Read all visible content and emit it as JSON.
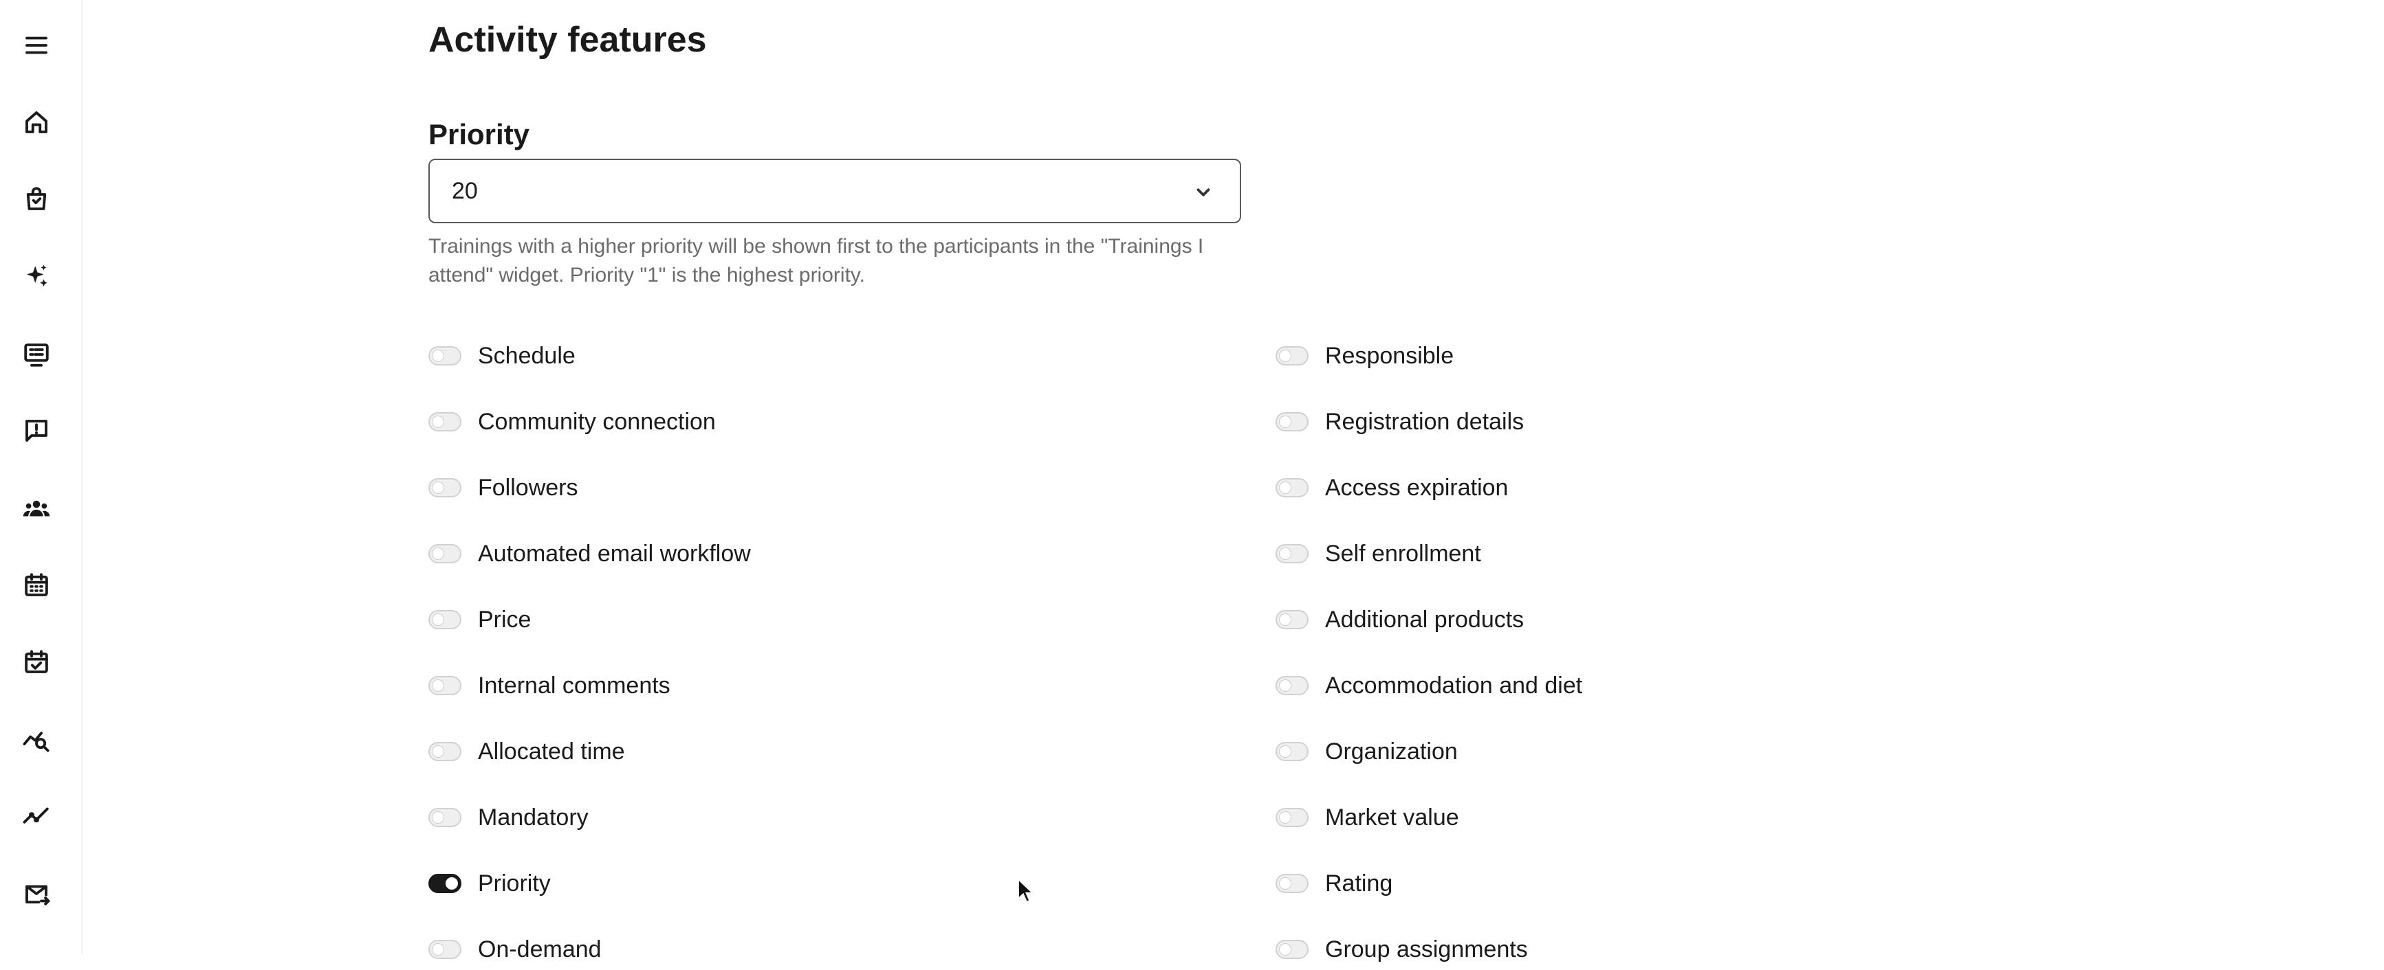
{
  "sidebar": {
    "items": [
      {
        "icon": "menu-icon"
      },
      {
        "icon": "home-icon"
      },
      {
        "icon": "shopping-bag-icon"
      },
      {
        "icon": "sparkles-icon"
      },
      {
        "icon": "monitor-list-icon"
      },
      {
        "icon": "feedback-icon"
      },
      {
        "icon": "users-icon"
      },
      {
        "icon": "calendar-icon"
      },
      {
        "icon": "calendar-check-icon"
      },
      {
        "icon": "analytics-search-icon"
      },
      {
        "icon": "trend-icon"
      },
      {
        "icon": "mail-forward-icon"
      }
    ]
  },
  "page": {
    "title": "Activity features",
    "priority": {
      "label": "Priority",
      "value": "20",
      "help": "Trainings with a higher priority will be shown first to the participants in the \"Trainings I attend\" widget. Priority \"1\" is the highest priority."
    }
  },
  "features": {
    "left": [
      {
        "label": "Schedule",
        "on": false
      },
      {
        "label": "Community connection",
        "on": false
      },
      {
        "label": "Followers",
        "on": false
      },
      {
        "label": "Automated email workflow",
        "on": false
      },
      {
        "label": "Price",
        "on": false
      },
      {
        "label": "Internal comments",
        "on": false
      },
      {
        "label": "Allocated time",
        "on": false
      },
      {
        "label": "Mandatory",
        "on": false
      },
      {
        "label": "Priority",
        "on": true
      },
      {
        "label": "On-demand",
        "on": false
      }
    ],
    "right": [
      {
        "label": "Responsible",
        "on": false
      },
      {
        "label": "Registration details",
        "on": false
      },
      {
        "label": "Access expiration",
        "on": false
      },
      {
        "label": "Self enrollment",
        "on": false
      },
      {
        "label": "Additional products",
        "on": false
      },
      {
        "label": "Accommodation and diet",
        "on": false
      },
      {
        "label": "Organization",
        "on": false
      },
      {
        "label": "Market value",
        "on": false
      },
      {
        "label": "Rating",
        "on": false
      },
      {
        "label": "Group assignments",
        "on": false
      }
    ]
  },
  "colors": {
    "toggle_on": "#1a1a1a",
    "toggle_off": "#efefef",
    "help_text": "#6b6b6b"
  }
}
